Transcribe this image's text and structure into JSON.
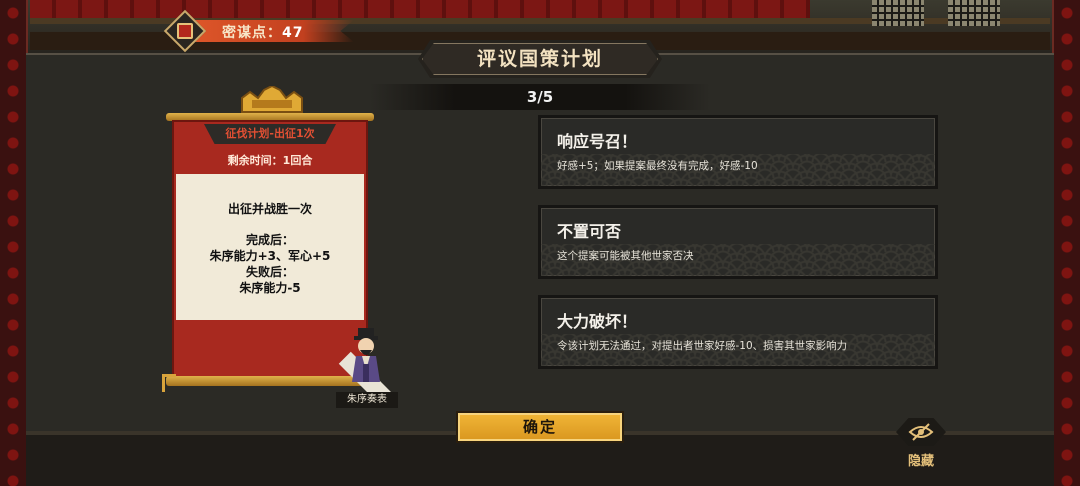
{
  "currency": {
    "label": "密谋点：",
    "value": "47",
    "icon": "scroll-seal-icon"
  },
  "title": "评议国策计划",
  "progress": "3/5",
  "plan_card": {
    "title": "征伐计划-出征1次",
    "remaining": "剩余时间：1回合",
    "goal": "出征并战胜一次",
    "success_label": "完成后：",
    "success_effect": "朱序能力+3、军心+5",
    "failure_label": "失败后：",
    "failure_effect": "朱序能力-5"
  },
  "proposer": {
    "name": "朱序奏表"
  },
  "options": [
    {
      "title": "响应号召！",
      "desc": "好感+5；如果提案最终没有完成，好感-10"
    },
    {
      "title": "不置可否",
      "desc": "这个提案可能被其他世家否决"
    },
    {
      "title": "大力破坏！",
      "desc": "令该计划无法通过，对提出者世家好感-10、损害其世家影响力"
    }
  ],
  "confirm_label": "确定",
  "hide_label": "隐藏",
  "colors": {
    "accent_gold": "#e8a92b",
    "card_red": "#a8291f",
    "panel_bg": "#2b2a25",
    "currency_banner": "#d24a24"
  }
}
